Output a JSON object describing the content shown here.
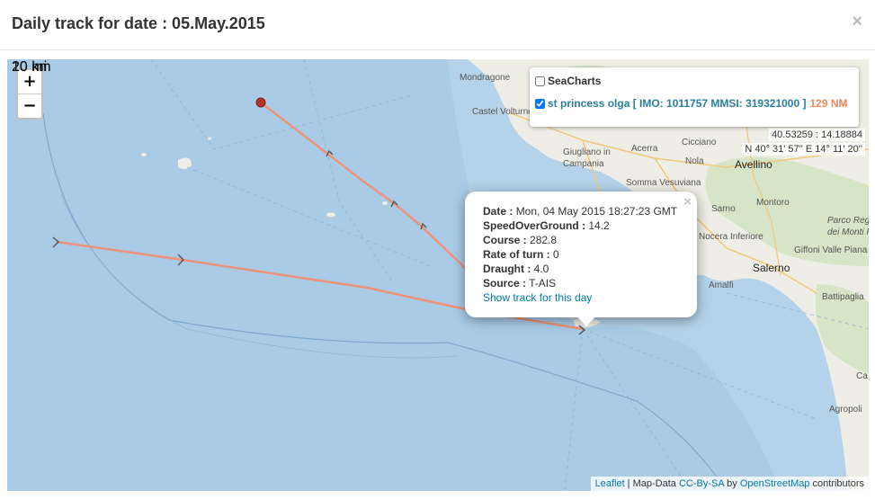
{
  "modal": {
    "title": "Daily track for date : 05.May.2015",
    "close_glyph": "×"
  },
  "map": {
    "zoom_in": "+",
    "zoom_out": "−",
    "layers": {
      "seacharts_label": "SeaCharts",
      "seacharts_checked": false,
      "vessel_label": "st princess olga [ IMO: 1011757 MMSI: 319321000 ]",
      "vessel_distance": "129 NM",
      "vessel_checked": true
    },
    "coords": {
      "decimal": "40.53259 : 14.18884",
      "dms": "N 40° 31' 57'' E 14° 11' 20''"
    },
    "places": {
      "mondragone": "Mondragone",
      "castel_volturno": "Castel Volturno",
      "giugliano": "Giugliano in",
      "campania": "Campania",
      "acerra": "Acerra",
      "cicciano": "Cicciano",
      "nola": "Nola",
      "avellino": "Avellino",
      "somma": "Somma Vesuviana",
      "sarno": "Sarno",
      "montoro": "Montoro",
      "parco1": "Parco Regio",
      "parco2": "dei Monti Pic",
      "nocera": "Nocera Inferiore",
      "giffoni": "Giffoni Valle Piana",
      "salerno": "Salerno",
      "amalfi": "Amalfi",
      "battipaglia": "Battipaglia",
      "agropoli": "Agropoli",
      "ca": "Ca"
    },
    "popup": {
      "close_glyph": "×",
      "date_label": "Date :",
      "date_value": "Mon, 04 May 2015 18:27:23 GMT",
      "speed_label": "SpeedOverGround :",
      "speed_value": "14.2",
      "course_label": "Course :",
      "course_value": "282.8",
      "rot_label": "Rate of turn :",
      "rot_value": "0",
      "draught_label": "Draught :",
      "draught_value": "4.0",
      "source_label": "Source :",
      "source_value": "T-AIS",
      "link": "Show track for this day"
    },
    "scale": {
      "km": "20 km",
      "mi": "10 mi"
    },
    "attribution": {
      "leaflet": "Leaflet",
      "sep1": " | Map-Data ",
      "license": "CC-By-SA",
      "by": " by ",
      "osm": "OpenStreetMap",
      "contributors": " contributors"
    },
    "colors": {
      "sea": "#a9cbe6",
      "land": "#efeee6",
      "track": "#ef8e72",
      "marker": "#b5342a"
    }
  }
}
